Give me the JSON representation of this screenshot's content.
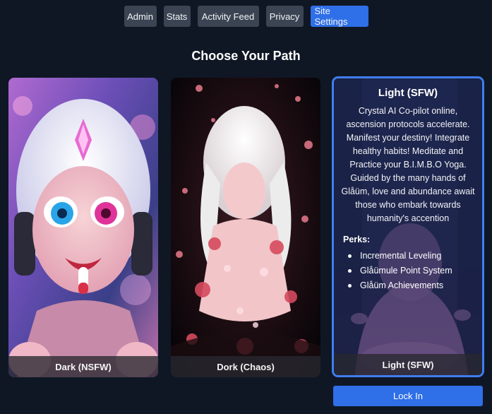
{
  "nav": {
    "items": [
      {
        "label": "Admin"
      },
      {
        "label": "Stats"
      },
      {
        "label": "Activity Feed"
      },
      {
        "label": "Privacy"
      },
      {
        "label": "Site Settings"
      }
    ],
    "active_index": 4
  },
  "page_title": "Choose Your Path",
  "cards": {
    "dark": {
      "caption": "Dark (NSFW)"
    },
    "dork": {
      "caption": "Dork (Chaos)"
    },
    "light": {
      "title": "Light (SFW)",
      "description": "Crystal AI Co-pilot online, ascension protocols accelerate. Manifest your destiny! Integrate healthy habits! Meditate and Practice your B.I.M.B.O Yoga. Guided by the many hands of Glåüm, love and abundance await those who embark towards humanity's accention",
      "perks_label": "Perks:",
      "perks": [
        "Incremental Leveling",
        "Glåümule Point System",
        "Glåüm Achievements"
      ],
      "caption": "Light (SFW)"
    }
  },
  "lock_in_label": "Lock In",
  "colors": {
    "background": "#0f1725",
    "accent": "#2f6fe8",
    "nav_button": "#3b4452"
  }
}
